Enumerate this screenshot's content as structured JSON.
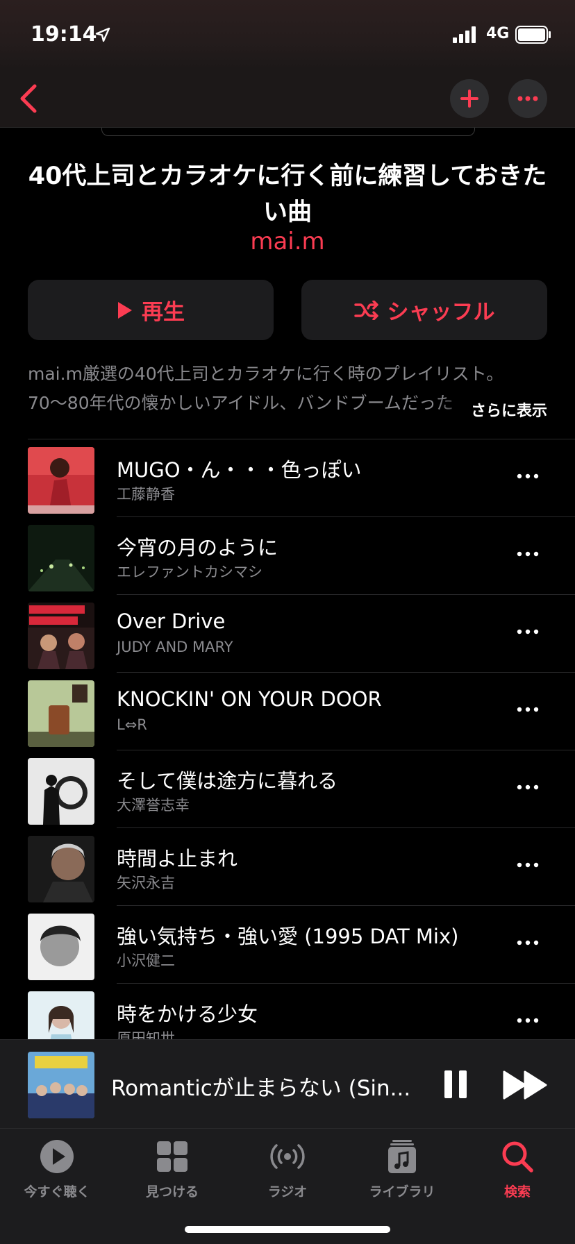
{
  "status": {
    "time": "19:14",
    "network": "4G"
  },
  "playlist": {
    "title": "40代上司とカラオケに行く前に練習しておきたい曲",
    "curator": "mai.m",
    "play_label": "再生",
    "shuffle_label": "シャッフル",
    "description_lines": [
      "mai.m厳選の40代上司とカラオケに行く時のプレイリスト。",
      "70〜80年代の懐かしいアイドル、バンドブームだった"
    ],
    "more_label": "さらに表示"
  },
  "tracks": [
    {
      "title": "MUGO・ん・・・色っぽい",
      "artist": "工藤静香"
    },
    {
      "title": "今宵の月のように",
      "artist": "エレファントカシマシ"
    },
    {
      "title": "Over Drive",
      "artist": "JUDY AND MARY"
    },
    {
      "title": "KNOCKIN' ON YOUR DOOR",
      "artist": "L⇔R"
    },
    {
      "title": "そして僕は途方に暮れる",
      "artist": "大澤誉志幸"
    },
    {
      "title": "時間よ止まれ",
      "artist": "矢沢永吉"
    },
    {
      "title": "強い気持ち・強い愛 (1995 DAT Mix)",
      "artist": "小沢健二"
    },
    {
      "title": "時をかける少女",
      "artist": "原田知世"
    }
  ],
  "now_playing": {
    "title": "Romanticが止まらない (Sin..."
  },
  "tabs": [
    {
      "label": "今すぐ聴く",
      "icon": "play-circle-icon"
    },
    {
      "label": "見つける",
      "icon": "grid-icon"
    },
    {
      "label": "ラジオ",
      "icon": "radio-icon"
    },
    {
      "label": "ライブラリ",
      "icon": "library-icon"
    },
    {
      "label": "検索",
      "icon": "search-icon",
      "active": true
    }
  ],
  "colors": {
    "accent": "#fb3c52",
    "background": "#000000",
    "secondary_text": "#8a8a8e"
  }
}
